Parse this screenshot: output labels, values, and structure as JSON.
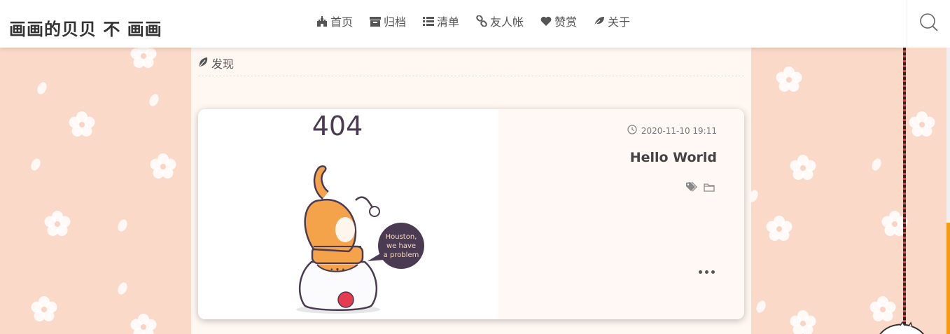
{
  "site": {
    "title": "画画的贝贝 不 画画"
  },
  "nav": [
    {
      "icon": "castle-icon",
      "label": "首页"
    },
    {
      "icon": "archive-icon",
      "label": "归档"
    },
    {
      "icon": "list-icon",
      "label": "清单"
    },
    {
      "icon": "link-icon",
      "label": "友人帐"
    },
    {
      "icon": "heart-icon",
      "label": "赞赏"
    },
    {
      "icon": "leaf-icon",
      "label": "关于"
    }
  ],
  "section": {
    "icon": "leaf-icon",
    "title": "发现"
  },
  "post": {
    "date": "2020-11-10 19:11",
    "title": "Hello World",
    "image": {
      "heading": "404",
      "bubble_line1": "Houston,",
      "bubble_line2": "we have",
      "bubble_line3": "a problem"
    }
  },
  "colors": {
    "background": "#fad9c9",
    "accent": "#f39c12",
    "header": "#ffffff"
  }
}
